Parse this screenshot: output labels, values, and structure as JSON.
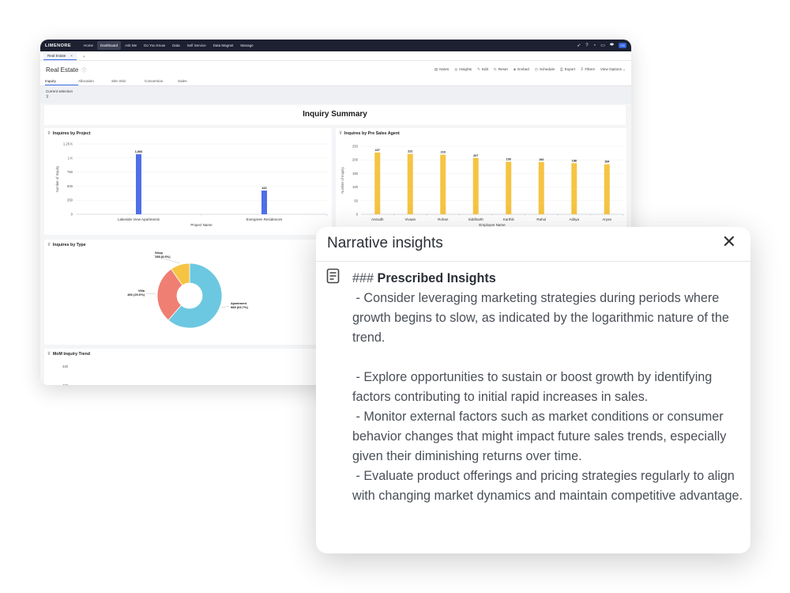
{
  "nav": {
    "logo": "LIMENORE",
    "items": [
      "Home",
      "Dashboard",
      "Ask Me",
      "Do You Know",
      "Data",
      "Self Service",
      "Data Magnet",
      "Manage"
    ],
    "active": "Dashboard",
    "user_initials": "AS"
  },
  "tab": {
    "label": "Real Estate",
    "close": "×",
    "add": "+"
  },
  "dashboard": {
    "title": "Real Estate",
    "actions": [
      {
        "icon": "notes-icon",
        "glyph": "▤",
        "label": "Notes"
      },
      {
        "icon": "insights-icon",
        "glyph": "◎",
        "label": "Insights"
      },
      {
        "icon": "edit-icon",
        "glyph": "✎",
        "label": "Edit"
      },
      {
        "icon": "reset-icon",
        "glyph": "↻",
        "label": "Reset"
      },
      {
        "icon": "embed-icon",
        "glyph": "◈",
        "label": "Embed"
      },
      {
        "icon": "schedule-icon",
        "glyph": "◷",
        "label": "Schedule"
      },
      {
        "icon": "export-icon",
        "glyph": "⎙",
        "label": "Export"
      },
      {
        "icon": "filter-icon",
        "glyph": "⊽",
        "label": "Filters"
      },
      {
        "icon": "chevron-down-icon",
        "glyph": "",
        "label": "View Options ⌄"
      }
    ],
    "subtabs": [
      "Inquiry",
      "Allocation",
      "Site Visit",
      "Conversion",
      "Sales"
    ],
    "active_subtab": "Inquiry",
    "current_selection": "Current selection",
    "summary_title": "Inquiry Summary"
  },
  "chart_data": [
    {
      "type": "bar",
      "title": "Inquires by Project",
      "xlabel": "Project Name",
      "ylabel": "Number of Inquiry",
      "categories": [
        "Lakeside View Apartments",
        "Evergreen Residences"
      ],
      "values": [
        1066,
        422
      ],
      "data_labels": [
        "1,066",
        "422"
      ],
      "ylim": [
        0,
        1250
      ],
      "yticks": [
        "0",
        "250",
        "500",
        "750",
        "1 K",
        "1.25 K"
      ],
      "color": "#4f6fe6"
    },
    {
      "type": "bar",
      "title": "Inquires by Pre Sales Agent",
      "xlabel": "Employee Name",
      "ylabel": "Number of Inquiry",
      "categories": [
        "Anirudh",
        "Vivaan",
        "Rohan",
        "Siddharth",
        "Karthik",
        "Rahul",
        "Aditya",
        "Aryan"
      ],
      "values": [
        227,
        222,
        219,
        207,
        193,
        192,
        188,
        184
      ],
      "ylim": [
        0,
        250
      ],
      "yticks": [
        "0",
        "50",
        "100",
        "150",
        "200",
        "250"
      ],
      "color": "#f6c443"
    },
    {
      "type": "pie",
      "title": "Inquires by Type",
      "slices": [
        {
          "name": "Apartment",
          "value": 989,
          "label": "989 (63.7%)",
          "color": "#6cc8e0"
        },
        {
          "name": "Villa",
          "value": 466,
          "label": "466 (29.0%)",
          "color": "#ef7f72"
        },
        {
          "name": "Shop",
          "value": 155,
          "label": "155 (9.6%)",
          "color": "#f6c443"
        }
      ]
    },
    {
      "type": "line",
      "title": "MoM Inquiry Trend",
      "yticks": [
        "440",
        "420"
      ]
    }
  ],
  "popup": {
    "title": "Narrative insights",
    "close": "✕",
    "heading_prefix": "### ",
    "heading": "Prescribed Insights",
    "body": " - Consider leveraging marketing strategies during periods where growth begins to slow, as indicated by the logarithmic nature of the trend.\n\n - Explore opportunities to sustain or boost growth by identifying factors contributing to initial rapid increases in sales.\n - Monitor external factors such as market conditions or consumer behavior changes that might impact future sales trends, especially given their diminishing returns over time.\n - Evaluate product offerings and pricing strategies regularly to align with changing market dynamics and maintain competitive advantage."
  }
}
